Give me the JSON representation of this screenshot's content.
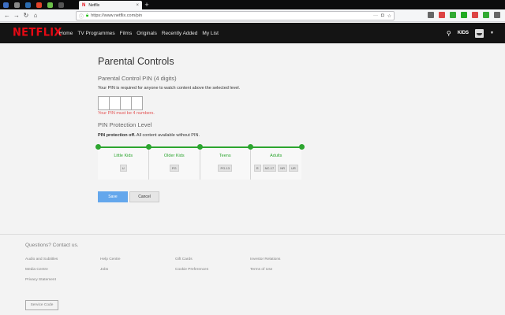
{
  "browser": {
    "tab_title": "Netflix",
    "tab_favicon": "N",
    "url": "https://www.netflix.com/pin",
    "pinned_tab_colors": [
      "#3d6fc4",
      "#888888",
      "#2b6cb0",
      "#e24329",
      "#6cc04a",
      "#555555"
    ],
    "toolbar_icon_colors": [
      "#666666",
      "#d44",
      "#3a3",
      "#2a2",
      "#d44",
      "#3a3",
      "#666666"
    ],
    "new_tab_label": "+"
  },
  "header": {
    "logo": "NETFLIX",
    "nav": [
      "Home",
      "TV Programmes",
      "Films",
      "Originals",
      "Recently Added",
      "My List"
    ],
    "kids_label": "KIDS"
  },
  "main": {
    "title": "Parental Controls",
    "pin_heading": "Parental Control PIN (4 digits)",
    "pin_description": "Your PIN is required for anyone to watch content above the selected level.",
    "pin_boxes": [
      "",
      "",
      "",
      ""
    ],
    "pin_error": "Your PIN must be 4 numbers.",
    "level_heading": "PIN Protection Level",
    "level_status_bold": "PIN protection off.",
    "level_status_rest": " All content available without PIN.",
    "levels": [
      {
        "name": "Little Kids",
        "ratings": [
          "U"
        ]
      },
      {
        "name": "Older Kids",
        "ratings": [
          "PG"
        ]
      },
      {
        "name": "Teens",
        "ratings": [
          "PG-13"
        ]
      },
      {
        "name": "Adults",
        "ratings": [
          "R",
          "NC-17",
          "NR",
          "UR"
        ]
      }
    ],
    "save_label": "Save",
    "cancel_label": "Cancel"
  },
  "footer": {
    "contact": "Questions? Contact us.",
    "links": [
      "Audio and Subtitles",
      "Help Centre",
      "Gift Cards",
      "Investor Relations",
      "Media Centre",
      "Jobs",
      "Cookie Preferences",
      "Terms of Use",
      "Privacy Statement"
    ],
    "service_code": "Service Code"
  },
  "colors": {
    "netflix_red": "#e50914",
    "header_bg": "#141414",
    "slider_green": "#2ca52f",
    "save_blue": "#64a7ec",
    "error_red": "#e35353"
  }
}
